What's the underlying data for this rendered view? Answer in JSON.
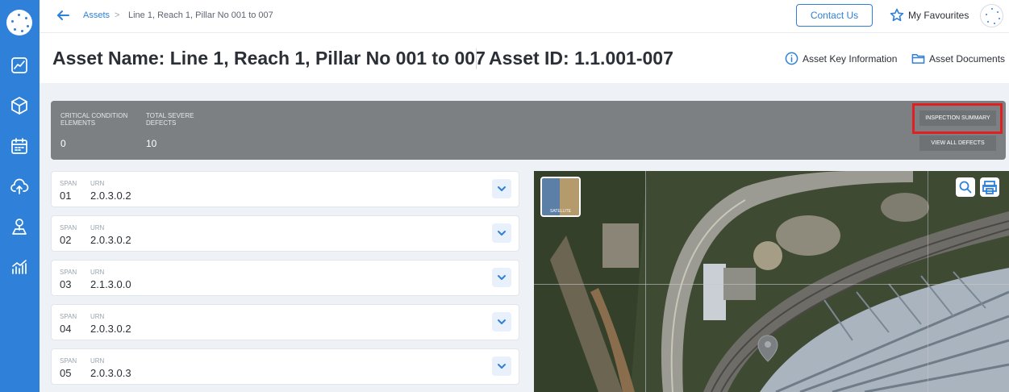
{
  "breadcrumb": {
    "link": "Assets",
    "separator": ">",
    "current": "Line 1, Reach 1, Pillar No 001 to 007"
  },
  "header": {
    "contact_label": "Contact Us",
    "favourites_label": "My Favourites",
    "asset_name": "Asset Name: Line 1, Reach 1, Pillar No 001 to 007",
    "asset_id": "Asset ID: 1.1.001-007",
    "key_info_label": "Asset Key Information",
    "documents_label": "Asset Documents"
  },
  "summary": {
    "critical_label": "CRITICAL CONDITION ELEMENTS",
    "critical_value": "0",
    "severe_label": "TOTAL SEVERE DEFECTS",
    "severe_value": "10",
    "inspection_summary_label": "INSPECTION SUMMARY",
    "view_all_defects_label": "VIEW ALL DEFECTS"
  },
  "spans": [
    {
      "span_label": "SPAN",
      "span": "01",
      "urn_label": "URN",
      "urn": "2.0.3.0.2"
    },
    {
      "span_label": "SPAN",
      "span": "02",
      "urn_label": "URN",
      "urn": "2.0.3.0.2"
    },
    {
      "span_label": "SPAN",
      "span": "03",
      "urn_label": "URN",
      "urn": "2.1.3.0.0"
    },
    {
      "span_label": "SPAN",
      "span": "04",
      "urn_label": "URN",
      "urn": "2.0.3.0.2"
    },
    {
      "span_label": "SPAN",
      "span": "05",
      "urn_label": "URN",
      "urn": "2.0.3.0.3"
    }
  ],
  "map": {
    "satellite_label": "SATELLITE"
  },
  "icons": {
    "sidebar": [
      "logo",
      "analytics-icon",
      "cube-icon",
      "calendar-icon",
      "cloud-upload-icon",
      "map-pin-icon",
      "chart-icon"
    ],
    "header": [
      "back-arrow-icon",
      "star-icon",
      "info-icon",
      "folder-icon"
    ],
    "map": [
      "search-icon",
      "print-icon",
      "map-marker-icon"
    ]
  },
  "colors": {
    "primary": "#2f80d8",
    "summary_bar": "#7c8082",
    "highlight": "#e02020"
  }
}
